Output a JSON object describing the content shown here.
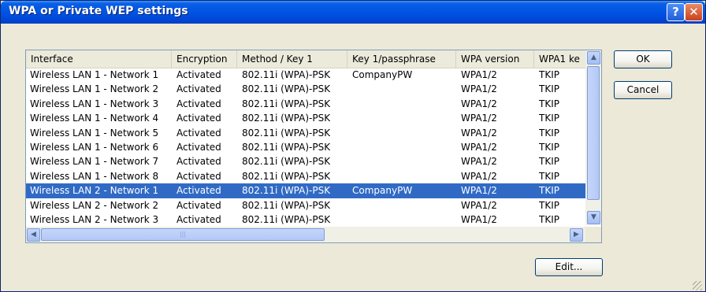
{
  "window": {
    "title": "WPA or Private WEP settings",
    "help_icon": "question-mark",
    "close_icon": "close-x"
  },
  "table": {
    "columns": [
      "Interface",
      "Encryption",
      "Method / Key 1",
      "Key 1/passphrase",
      "WPA version",
      "WPA1 ke"
    ],
    "rows": [
      [
        "Wireless LAN 1 - Network 1",
        "Activated",
        "802.11i (WPA)-PSK",
        "CompanyPW",
        "WPA1/2",
        "TKIP"
      ],
      [
        "Wireless LAN 1 - Network 2",
        "Activated",
        "802.11i (WPA)-PSK",
        "",
        "WPA1/2",
        "TKIP"
      ],
      [
        "Wireless LAN 1 - Network 3",
        "Activated",
        "802.11i (WPA)-PSK",
        "",
        "WPA1/2",
        "TKIP"
      ],
      [
        "Wireless LAN 1 - Network 4",
        "Activated",
        "802.11i (WPA)-PSK",
        "",
        "WPA1/2",
        "TKIP"
      ],
      [
        "Wireless LAN 1 - Network 5",
        "Activated",
        "802.11i (WPA)-PSK",
        "",
        "WPA1/2",
        "TKIP"
      ],
      [
        "Wireless LAN 1 - Network 6",
        "Activated",
        "802.11i (WPA)-PSK",
        "",
        "WPA1/2",
        "TKIP"
      ],
      [
        "Wireless LAN 1 - Network 7",
        "Activated",
        "802.11i (WPA)-PSK",
        "",
        "WPA1/2",
        "TKIP"
      ],
      [
        "Wireless LAN 1 - Network 8",
        "Activated",
        "802.11i (WPA)-PSK",
        "",
        "WPA1/2",
        "TKIP"
      ],
      [
        "Wireless LAN 2 - Network 1",
        "Activated",
        "802.11i (WPA)-PSK",
        "CompanyPW",
        "WPA1/2",
        "TKIP"
      ],
      [
        "Wireless LAN 2 - Network 2",
        "Activated",
        "802.11i (WPA)-PSK",
        "",
        "WPA1/2",
        "TKIP"
      ],
      [
        "Wireless LAN 2 - Network 3",
        "Activated",
        "802.11i (WPA)-PSK",
        "",
        "WPA1/2",
        "TKIP"
      ]
    ],
    "selected_row": 8
  },
  "buttons": {
    "ok": "OK",
    "cancel": "Cancel",
    "edit": "Edit..."
  },
  "colors": {
    "titlebar": "#0054e3",
    "selection": "#316ac5"
  }
}
